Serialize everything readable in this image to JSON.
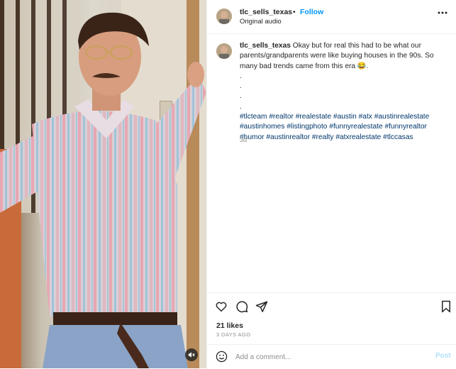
{
  "post": {
    "username": "tlc_sells_texas",
    "dot": "•",
    "follow_label": "Follow",
    "audio": "Original audio"
  },
  "caption": {
    "username": "tlc_sells_texas",
    "line1": " Okay but for real this had to be what our",
    "line2": "parents/grandparents were like buying houses in the 90s. So",
    "line3": "many bad trends came from this era 😂.",
    "dots": [
      ".",
      ".",
      ".",
      "."
    ],
    "hashtag_lines": [
      "#tlcteam #realtor #realestate #austin #atx #austinrealestate",
      "#austinhomes #listingphoto #funnyrealestate #funnyrealtor",
      "#humor #austinrealtor #realty #atxrealestate #tlccasas"
    ],
    "time": "3d"
  },
  "engagement": {
    "likes": "21 likes",
    "date": "3 DAYS AGO"
  },
  "comment": {
    "placeholder": "Add a comment...",
    "post_label": "Post"
  },
  "icons": {
    "more": "more-options-icon",
    "like": "heart-icon",
    "comment": "comment-icon",
    "share": "share-icon",
    "save": "bookmark-icon",
    "emoji": "emoji-icon",
    "mute": "speaker-muted-icon"
  },
  "colors": {
    "follow": "#0095f6",
    "hashtag": "#00376b",
    "muted_text": "#8e8e8e",
    "post_disabled": "#b2dffc"
  }
}
